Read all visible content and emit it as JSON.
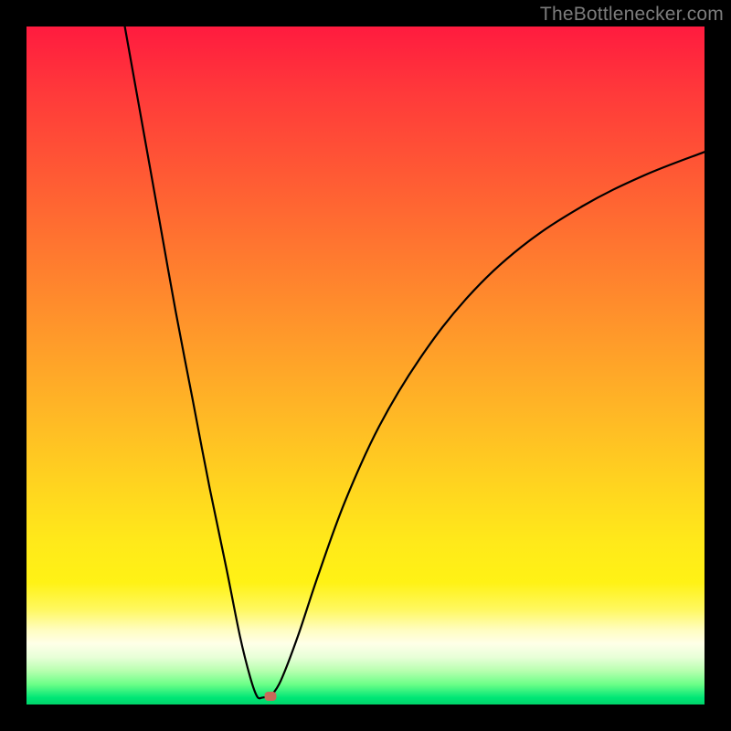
{
  "watermark": "TheBottlenecker.com",
  "chart_data": {
    "type": "line",
    "title": "",
    "xlabel": "",
    "ylabel": "",
    "xlim": [
      0,
      100
    ],
    "ylim": [
      0,
      100
    ],
    "curve": {
      "left_leg": [
        {
          "x": 14.5,
          "y": 100
        },
        {
          "x": 17,
          "y": 86
        },
        {
          "x": 19.5,
          "y": 72
        },
        {
          "x": 22,
          "y": 58
        },
        {
          "x": 24.5,
          "y": 45
        },
        {
          "x": 27,
          "y": 32
        },
        {
          "x": 29.5,
          "y": 20
        },
        {
          "x": 31.5,
          "y": 10
        },
        {
          "x": 33,
          "y": 4
        },
        {
          "x": 34,
          "y": 1.2
        },
        {
          "x": 34.7,
          "y": 1.0
        }
      ],
      "right_leg": [
        {
          "x": 36,
          "y": 1.2
        },
        {
          "x": 37.5,
          "y": 3.5
        },
        {
          "x": 40,
          "y": 10
        },
        {
          "x": 43,
          "y": 19
        },
        {
          "x": 47,
          "y": 30
        },
        {
          "x": 52,
          "y": 41
        },
        {
          "x": 58,
          "y": 51
        },
        {
          "x": 65,
          "y": 60
        },
        {
          "x": 73,
          "y": 67.5
        },
        {
          "x": 82,
          "y": 73.5
        },
        {
          "x": 91,
          "y": 78
        },
        {
          "x": 100,
          "y": 81.5
        }
      ]
    },
    "marker": {
      "x": 36,
      "y": 1.2
    },
    "colors": {
      "curve_stroke": "#000000",
      "marker_fill": "#c76a5a",
      "background_top": "#ff1b3f",
      "background_bottom": "#00d46a"
    }
  }
}
